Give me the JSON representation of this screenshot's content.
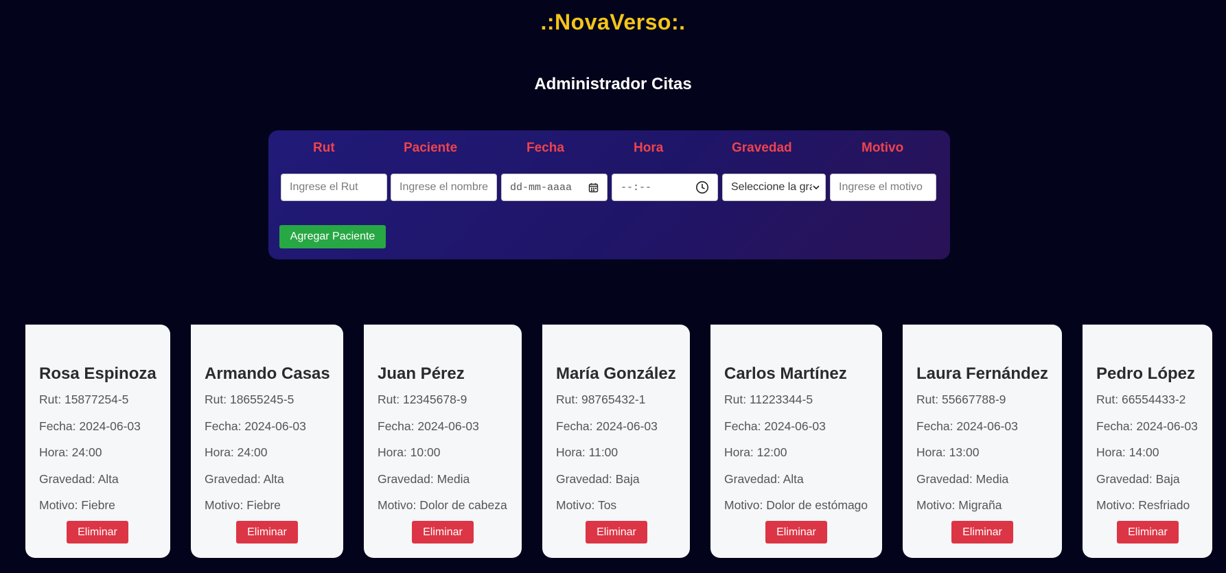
{
  "header": {
    "brand": ".:NovaVerso:.",
    "title": "Administrador Citas"
  },
  "form": {
    "labels": {
      "rut": "Rut",
      "paciente": "Paciente",
      "fecha": "Fecha",
      "hora": "Hora",
      "gravedad": "Gravedad",
      "motivo": "Motivo"
    },
    "placeholders": {
      "rut": "Ingrese el Rut",
      "paciente": "Ingrese el nombre",
      "fecha": "dd-mm-aaaa",
      "hora": "--:--",
      "gravedad": "Seleccione la gravedad",
      "motivo": "Ingrese el motivo"
    },
    "submit_label": "Agregar Paciente"
  },
  "field_prefixes": {
    "rut": "Rut: ",
    "fecha": "Fecha: ",
    "hora": "Hora: ",
    "gravedad": "Gravedad: ",
    "motivo": "Motivo: "
  },
  "delete_label": "Eliminar",
  "patients": [
    {
      "nombre": "Rosa Espinoza",
      "rut": "15877254-5",
      "fecha": "2024-06-03",
      "hora": "24:00",
      "gravedad": "Alta",
      "motivo": "Fiebre"
    },
    {
      "nombre": "Armando Casas",
      "rut": "18655245-5",
      "fecha": "2024-06-03",
      "hora": "24:00",
      "gravedad": "Alta",
      "motivo": "Fiebre"
    },
    {
      "nombre": "Juan Pérez",
      "rut": "12345678-9",
      "fecha": "2024-06-03",
      "hora": "10:00",
      "gravedad": "Media",
      "motivo": "Dolor de cabeza"
    },
    {
      "nombre": "María González",
      "rut": "98765432-1",
      "fecha": "2024-06-03",
      "hora": "11:00",
      "gravedad": "Baja",
      "motivo": "Tos"
    },
    {
      "nombre": "Carlos Martínez",
      "rut": "11223344-5",
      "fecha": "2024-06-03",
      "hora": "12:00",
      "gravedad": "Alta",
      "motivo": "Dolor de estómago"
    },
    {
      "nombre": "Laura Fernández",
      "rut": "55667788-9",
      "fecha": "2024-06-03",
      "hora": "13:00",
      "gravedad": "Media",
      "motivo": "Migraña"
    },
    {
      "nombre": "Pedro López",
      "rut": "66554433-2",
      "fecha": "2024-06-03",
      "hora": "14:00",
      "gravedad": "Baja",
      "motivo": "Resfriado"
    }
  ]
}
